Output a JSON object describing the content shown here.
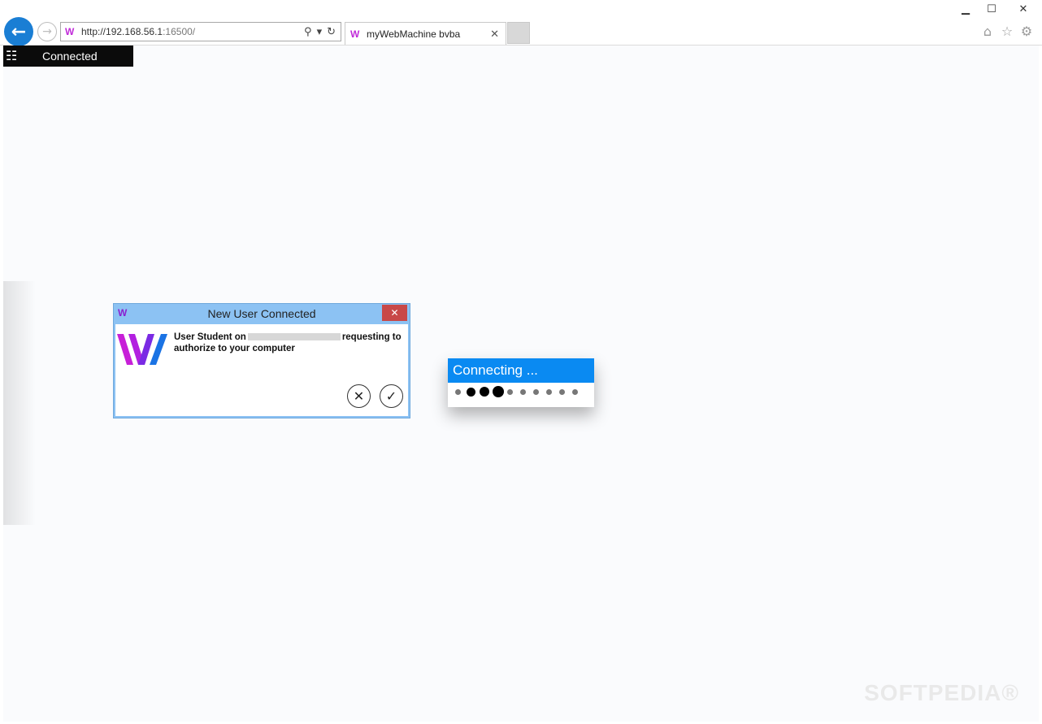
{
  "browser": {
    "window_controls": {
      "minimize": "▁",
      "maximize": "☐",
      "close": "✕"
    },
    "address": {
      "value": "http://192.168.56.1",
      "port": ":16500/"
    },
    "tab": {
      "title": "myWebMachine bvba",
      "close": "✕"
    },
    "icons": {
      "back": "←",
      "forward": "→",
      "search": "⚲",
      "dropdown": "▾",
      "refresh": "↻",
      "home": "⌂",
      "favorites": "☆",
      "settings": "⚙"
    }
  },
  "connection_bar": {
    "label": "Connected"
  },
  "dialog": {
    "title": "New User Connected",
    "close": "✕",
    "message_part1": "User Student on",
    "message_part2": "requesting to authorize to your computer",
    "deny_icon": "✕",
    "accept_icon": "✓"
  },
  "connecting": {
    "label": "Connecting ..."
  },
  "watermark": "SOFTPEDIA®",
  "colors": {
    "accent": "#0a8af2",
    "dialog_title_bg": "#8cc2f3",
    "close_red": "#c84848"
  }
}
